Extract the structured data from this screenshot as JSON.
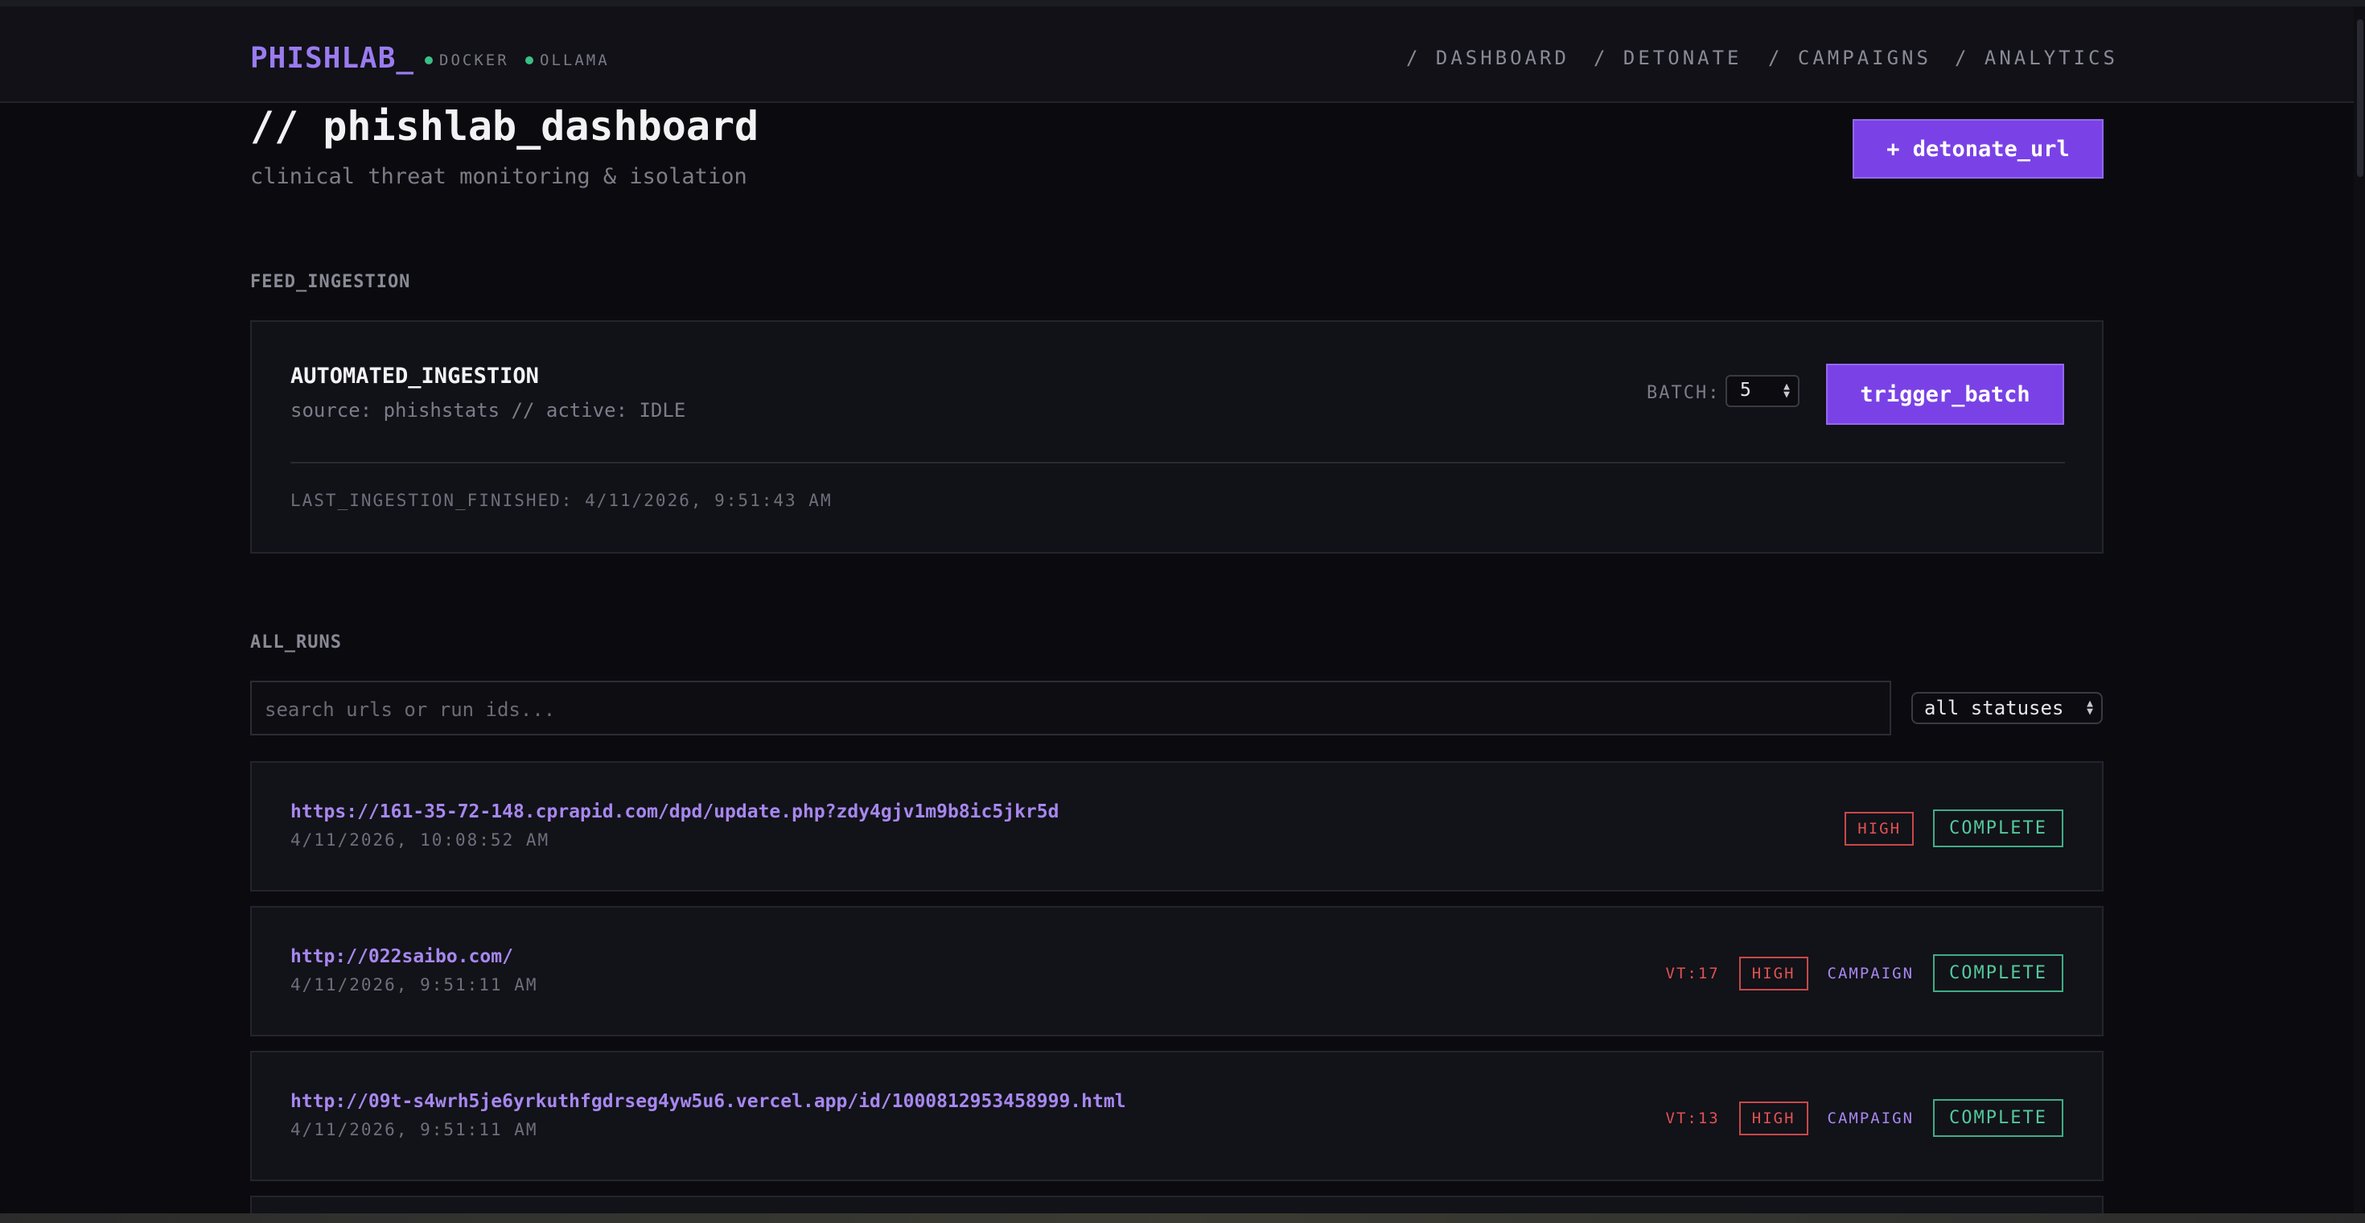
{
  "header": {
    "brand": "PHISHLAB_",
    "services": [
      {
        "name": "DOCKER",
        "color": "#3bbf86"
      },
      {
        "name": "OLLAMA",
        "color": "#3bbf86"
      }
    ],
    "nav": [
      "/ DASHBOARD",
      "/ DETONATE",
      "/ CAMPAIGNS",
      "/ ANALYTICS"
    ]
  },
  "page": {
    "title": "// phishlab_dashboard",
    "subtitle": "clinical threat monitoring & isolation",
    "detonate_button": "+ detonate_url"
  },
  "feed": {
    "section_label": "FEED_INGESTION",
    "title": "AUTOMATED_INGESTION",
    "source": "source: phishstats // active: IDLE",
    "batch_label": "BATCH:",
    "batch_value": "5",
    "trigger_button": "trigger_batch",
    "last_finished": "LAST_INGESTION_FINISHED: 4/11/2026, 9:51:43 AM"
  },
  "runs": {
    "section_label": "ALL_RUNS",
    "search_placeholder": "search urls or run ids...",
    "status_filter": "all statuses",
    "items": [
      {
        "url": "https://161-35-72-148.cprapid.com/dpd/update.php?zdy4gjv1m9b8ic5jkr5d",
        "time": "4/11/2026, 10:08:52 AM",
        "vt": "",
        "risk": "HIGH",
        "campaign": "",
        "status": "COMPLETE"
      },
      {
        "url": "http://022saibo.com/",
        "time": "4/11/2026, 9:51:11 AM",
        "vt": "VT:17",
        "risk": "HIGH",
        "campaign": "CAMPAIGN",
        "status": "COMPLETE"
      },
      {
        "url": "http://09t-s4wrh5je6yrkuthfgdrseg4yw5u6.vercel.app/id/1000812953458999.html",
        "time": "4/11/2026, 9:51:11 AM",
        "vt": "VT:13",
        "risk": "HIGH",
        "campaign": "CAMPAIGN",
        "status": "COMPLETE"
      }
    ]
  },
  "colors": {
    "accent": "#7a42e6",
    "high": "#e05252",
    "complete": "#54c99a",
    "link": "#a787ef"
  }
}
